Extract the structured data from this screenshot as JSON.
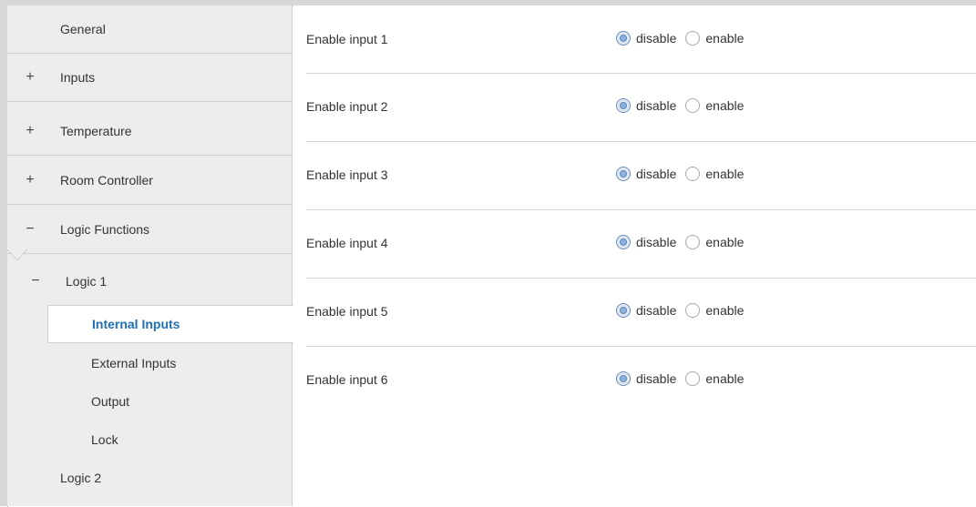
{
  "sidebar": {
    "items": [
      {
        "label": "General",
        "sign": ""
      },
      {
        "label": "Inputs",
        "sign": "+"
      },
      {
        "label": "Temperature",
        "sign": "+"
      },
      {
        "label": "Room Controller",
        "sign": "+"
      },
      {
        "label": "Logic Functions",
        "sign": "−"
      }
    ],
    "logic1": {
      "label": "Logic 1",
      "sign": "−"
    },
    "sub_items": [
      {
        "label": "Internal Inputs",
        "selected": true
      },
      {
        "label": "External Inputs",
        "selected": false
      },
      {
        "label": "Output",
        "selected": false
      },
      {
        "label": "Lock",
        "selected": false
      }
    ],
    "logic2": {
      "label": "Logic 2"
    }
  },
  "main": {
    "options": {
      "disable": "disable",
      "enable": "enable"
    },
    "rows": [
      {
        "label": "Enable input 1",
        "value": "disable"
      },
      {
        "label": "Enable input 2",
        "value": "disable"
      },
      {
        "label": "Enable input 3",
        "value": "disable"
      },
      {
        "label": "Enable input 4",
        "value": "disable"
      },
      {
        "label": "Enable input 5",
        "value": "disable"
      },
      {
        "label": "Enable input 6",
        "value": "disable"
      }
    ]
  },
  "colors": {
    "selected_text": "#1e6fb8",
    "sidebar_bg": "#ededed",
    "radio_checked": "#8fb2da"
  }
}
